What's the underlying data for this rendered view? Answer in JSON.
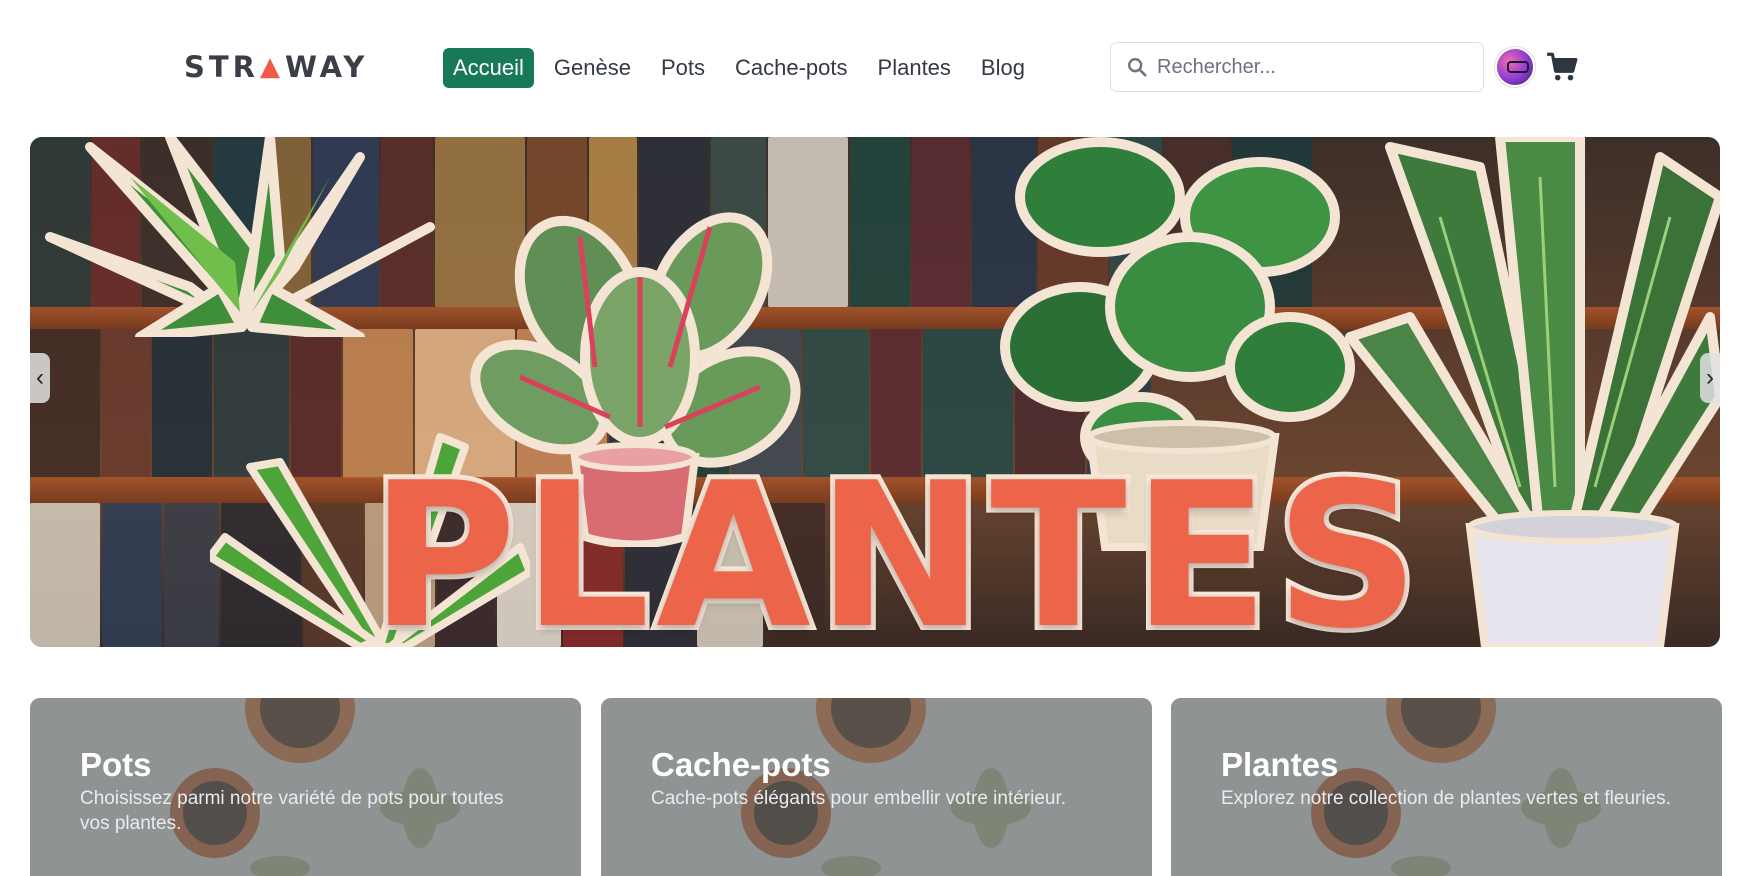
{
  "brand": {
    "logo_left": "STR",
    "logo_mark": "▲",
    "logo_right": "WAY"
  },
  "nav": {
    "items": [
      {
        "label": "Accueil",
        "active": true
      },
      {
        "label": "Genèse",
        "active": false
      },
      {
        "label": "Pots",
        "active": false
      },
      {
        "label": "Cache-pots",
        "active": false
      },
      {
        "label": "Plantes",
        "active": false
      },
      {
        "label": "Blog",
        "active": false
      }
    ]
  },
  "search": {
    "placeholder": "Rechercher..."
  },
  "icons": {
    "search": "search-icon",
    "avatar": "user-avatar",
    "cart": "shopping-cart-icon",
    "prev": "chevron-left-icon",
    "next": "chevron-right-icon"
  },
  "hero": {
    "title": "PLANTES",
    "prev_label": "‹",
    "next_label": "›",
    "slides_count": 3,
    "active_slide": 3
  },
  "categories": [
    {
      "title": "Pots",
      "description": "Choisissez parmi notre variété de pots pour toutes vos plantes."
    },
    {
      "title": "Cache-pots",
      "description": "Cache-pots élégants pour embellir votre intérieur."
    },
    {
      "title": "Plantes",
      "description": "Explorez notre collection de plantes vertes et fleuries."
    }
  ],
  "colors": {
    "accent": "#17795a",
    "title_orange": "#ec6449",
    "title_outline": "#f6e6d8",
    "text": "#333a45"
  }
}
